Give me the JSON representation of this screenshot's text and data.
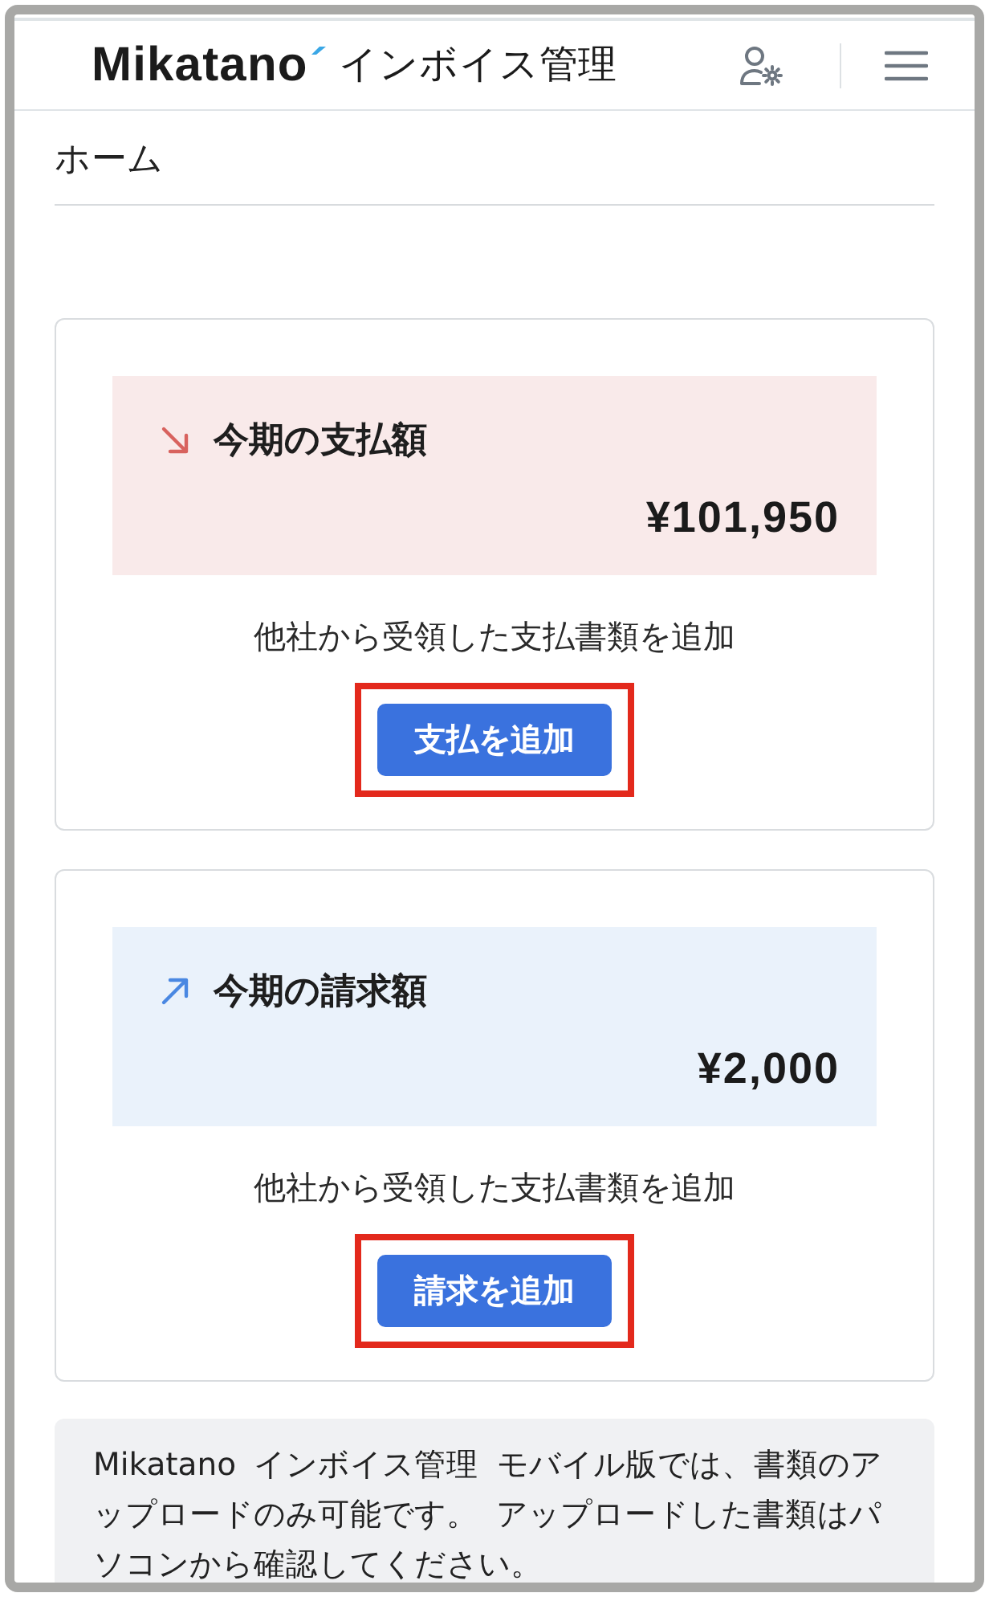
{
  "header": {
    "logo": "Mikatano",
    "app_name": "インボイス管理"
  },
  "page_title": "ホーム",
  "summary_cards": [
    {
      "kind": "payable",
      "title": "今期の支払額",
      "amount": "¥101,950",
      "description": "他社から受領した支払書類を追加",
      "button": "支払を追加",
      "highlighted": true
    },
    {
      "kind": "receivable",
      "title": "今期の請求額",
      "amount": "¥2,000",
      "description": "他社から受領した支払書類を追加",
      "button": "請求を追加",
      "highlighted": true
    }
  ],
  "notice": "Mikatano インボイス管理 モバイル版では、書類のアップロードのみ可能です。 アップロードした書類はパソコンから確認してください。"
}
